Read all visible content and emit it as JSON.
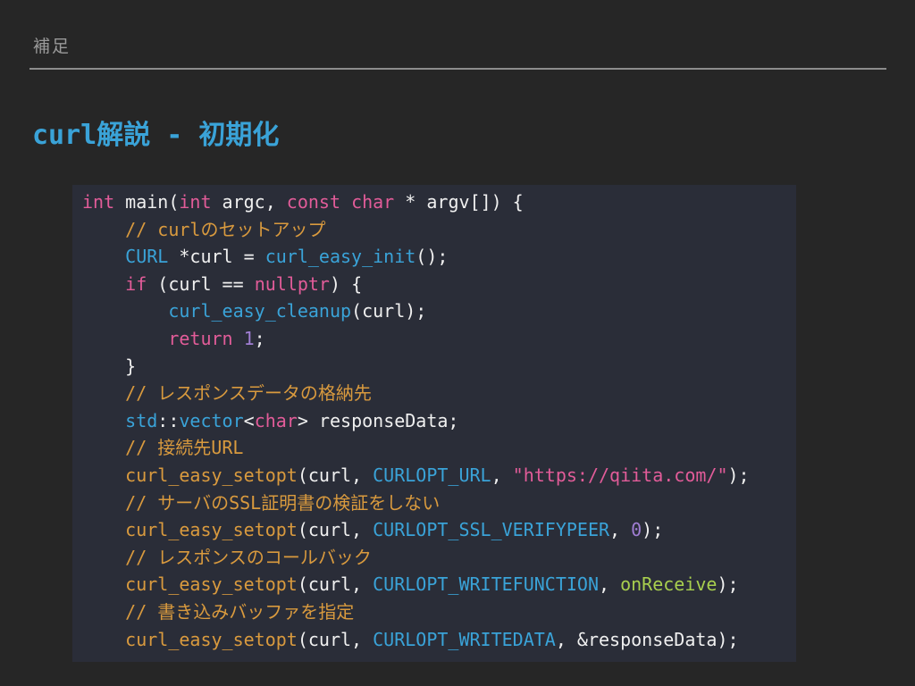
{
  "header": {
    "section_label": "補足"
  },
  "slide": {
    "title": "curl解説 - 初期化"
  },
  "code": {
    "lines": [
      [
        {
          "t": "kw",
          "v": "int"
        },
        {
          "t": "plain",
          "v": " main("
        },
        {
          "t": "kw",
          "v": "int"
        },
        {
          "t": "plain",
          "v": " argc, "
        },
        {
          "t": "kw",
          "v": "const"
        },
        {
          "t": "plain",
          "v": " "
        },
        {
          "t": "kw",
          "v": "char"
        },
        {
          "t": "plain",
          "v": " * argv[]) {"
        }
      ],
      [
        {
          "t": "plain",
          "v": "    "
        },
        {
          "t": "com",
          "v": "// curlのセットアップ"
        }
      ],
      [
        {
          "t": "plain",
          "v": "    "
        },
        {
          "t": "type",
          "v": "CURL"
        },
        {
          "t": "plain",
          "v": " *curl = "
        },
        {
          "t": "fnblue",
          "v": "curl_easy_init"
        },
        {
          "t": "plain",
          "v": "();"
        }
      ],
      [
        {
          "t": "plain",
          "v": "    "
        },
        {
          "t": "kw",
          "v": "if"
        },
        {
          "t": "plain",
          "v": " (curl == "
        },
        {
          "t": "kw",
          "v": "nullptr"
        },
        {
          "t": "plain",
          "v": ") {"
        }
      ],
      [
        {
          "t": "plain",
          "v": "        "
        },
        {
          "t": "fnblue",
          "v": "curl_easy_cleanup"
        },
        {
          "t": "plain",
          "v": "(curl);"
        }
      ],
      [
        {
          "t": "plain",
          "v": "        "
        },
        {
          "t": "kw",
          "v": "return"
        },
        {
          "t": "plain",
          "v": " "
        },
        {
          "t": "num",
          "v": "1"
        },
        {
          "t": "plain",
          "v": ";"
        }
      ],
      [
        {
          "t": "plain",
          "v": "    }"
        }
      ],
      [
        {
          "t": "plain",
          "v": "    "
        },
        {
          "t": "com",
          "v": "// レスポンスデータの格納先"
        }
      ],
      [
        {
          "t": "plain",
          "v": "    "
        },
        {
          "t": "type",
          "v": "std"
        },
        {
          "t": "plain",
          "v": "::"
        },
        {
          "t": "type",
          "v": "vector"
        },
        {
          "t": "plain",
          "v": "<"
        },
        {
          "t": "kw",
          "v": "char"
        },
        {
          "t": "plain",
          "v": "> responseData;"
        }
      ],
      [
        {
          "t": "plain",
          "v": "    "
        },
        {
          "t": "com",
          "v": "// 接続先URL"
        }
      ],
      [
        {
          "t": "plain",
          "v": "    "
        },
        {
          "t": "fn",
          "v": "curl_easy_setopt"
        },
        {
          "t": "plain",
          "v": "(curl, "
        },
        {
          "t": "const",
          "v": "CURLOPT_URL"
        },
        {
          "t": "plain",
          "v": ", "
        },
        {
          "t": "str",
          "v": "\"https://qiita.com/\""
        },
        {
          "t": "plain",
          "v": ");"
        }
      ],
      [
        {
          "t": "plain",
          "v": "    "
        },
        {
          "t": "com",
          "v": "// サーバのSSL証明書の検証をしない"
        }
      ],
      [
        {
          "t": "plain",
          "v": "    "
        },
        {
          "t": "fn",
          "v": "curl_easy_setopt"
        },
        {
          "t": "plain",
          "v": "(curl, "
        },
        {
          "t": "const",
          "v": "CURLOPT_SSL_VERIFYPEER"
        },
        {
          "t": "plain",
          "v": ", "
        },
        {
          "t": "num",
          "v": "0"
        },
        {
          "t": "plain",
          "v": ");"
        }
      ],
      [
        {
          "t": "plain",
          "v": "    "
        },
        {
          "t": "com",
          "v": "// レスポンスのコールバック"
        }
      ],
      [
        {
          "t": "plain",
          "v": "    "
        },
        {
          "t": "fn",
          "v": "curl_easy_setopt"
        },
        {
          "t": "plain",
          "v": "(curl, "
        },
        {
          "t": "const",
          "v": "CURLOPT_WRITEFUNCTION"
        },
        {
          "t": "plain",
          "v": ", "
        },
        {
          "t": "green",
          "v": "onReceive"
        },
        {
          "t": "plain",
          "v": ");"
        }
      ],
      [
        {
          "t": "plain",
          "v": "    "
        },
        {
          "t": "com",
          "v": "// 書き込みバッファを指定"
        }
      ],
      [
        {
          "t": "plain",
          "v": "    "
        },
        {
          "t": "fn",
          "v": "curl_easy_setopt"
        },
        {
          "t": "plain",
          "v": "(curl, "
        },
        {
          "t": "const",
          "v": "CURLOPT_WRITEDATA"
        },
        {
          "t": "plain",
          "v": ", &responseData);"
        }
      ]
    ]
  },
  "colors": {
    "background": "#262626",
    "code_background": "#2a2d38",
    "title": "#3aa3d8",
    "keyword": "#e25c99",
    "type": "#3aa3d8",
    "function": "#d99a3e",
    "comment": "#d99a3e",
    "number": "#a07ed3",
    "identifier_green": "#a8cf4e"
  }
}
